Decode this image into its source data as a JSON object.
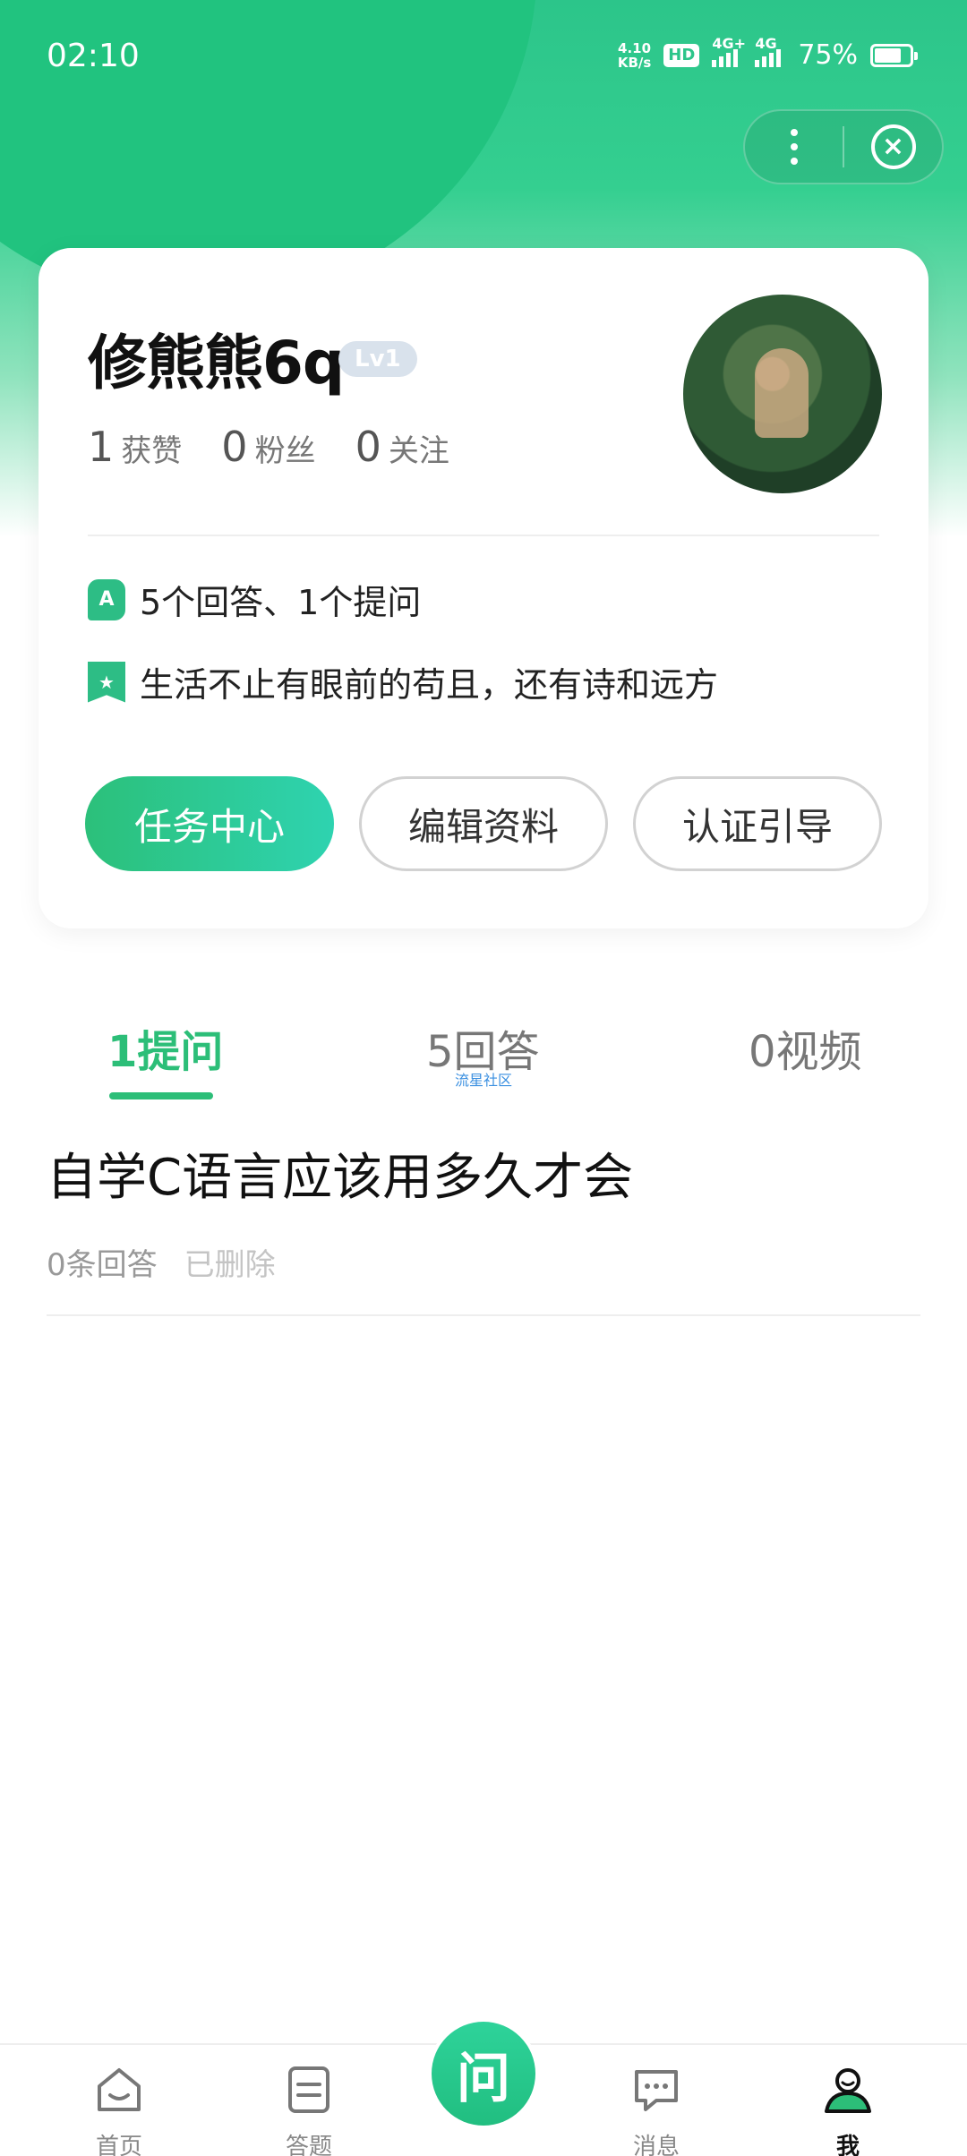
{
  "status_bar": {
    "time": "02:10",
    "net_speed_value": "4.10",
    "net_speed_unit": "KB/s",
    "hd": "HD",
    "signal1": "4G+",
    "signal2": "4G",
    "battery": "75%"
  },
  "profile": {
    "name": "修熊熊6q",
    "level": "Lv1",
    "stats": [
      {
        "num": "1",
        "label": "获赞"
      },
      {
        "num": "0",
        "label": "粉丝"
      },
      {
        "num": "0",
        "label": "关注"
      }
    ],
    "summary": "5个回答、1个提问",
    "motto": "生活不止有眼前的苟且，还有诗和远方"
  },
  "buttons": {
    "task_center": "任务中心",
    "edit_profile": "编辑资料",
    "verify_guide": "认证引导"
  },
  "tabs": [
    {
      "label": "1提问",
      "active": true
    },
    {
      "label": "5回答",
      "active": false
    },
    {
      "label": "0视频",
      "active": false
    }
  ],
  "watermark": "流星社区",
  "question": {
    "title": "自学C语言应该用多久才会",
    "answers": "0条回答",
    "status": "已删除"
  },
  "bottom_nav": {
    "home": "首页",
    "answer": "答题",
    "center": "问",
    "messages": "消息",
    "me": "我"
  },
  "colors": {
    "accent": "#2cbe78",
    "header": "#21c37f"
  }
}
